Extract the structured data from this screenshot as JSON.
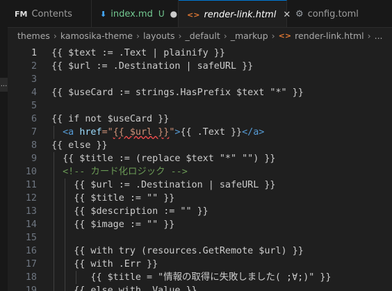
{
  "tabs": [
    {
      "icon": "FM",
      "label": "Contents"
    },
    {
      "icon": "⬇",
      "label": "index.md",
      "status": "U"
    },
    {
      "icon": "<>",
      "label": "render-link.html",
      "close": "✕"
    },
    {
      "icon": "⚙",
      "label": "config.toml"
    }
  ],
  "breadcrumb": [
    "themes",
    "kamosika-theme",
    "layouts",
    "_default",
    "_markup",
    "render-link.html",
    "..."
  ],
  "left_marker": "...",
  "lines": [
    {
      "n": "1",
      "parts": [
        {
          "t": "{{ $text := .Text | plainify }}"
        }
      ]
    },
    {
      "n": "2",
      "parts": [
        {
          "t": "{{ $url := .Destination | safeURL }}"
        }
      ]
    },
    {
      "n": "3",
      "parts": []
    },
    {
      "n": "4",
      "parts": [
        {
          "t": "{{ $useCard := strings.HasPrefix $text \"*\" }}"
        }
      ]
    },
    {
      "n": "5",
      "parts": []
    },
    {
      "n": "6",
      "parts": [
        {
          "t": "{{ if not $useCard }}"
        }
      ]
    },
    {
      "n": "7",
      "parts": [
        {
          "t": "  "
        },
        {
          "t": "<a",
          "c": "tag"
        },
        {
          "t": " "
        },
        {
          "t": "href",
          "c": "attr"
        },
        {
          "t": "=",
          "c": "str"
        },
        {
          "t": "\"",
          "c": "str"
        },
        {
          "t": "{{ $url }}",
          "c": "str err"
        },
        {
          "t": "\"",
          "c": "str"
        },
        {
          "t": ">",
          "c": "tag"
        },
        {
          "t": "{{ .Text }}"
        },
        {
          "t": "</a>",
          "c": "tag"
        }
      ]
    },
    {
      "n": "8",
      "parts": [
        {
          "t": "{{ else }}"
        }
      ]
    },
    {
      "n": "9",
      "parts": [
        {
          "t": "  {{ $title := (replace $text \"*\" \"\") }}"
        }
      ]
    },
    {
      "n": "10",
      "parts": [
        {
          "t": "  "
        },
        {
          "t": "<!-- カード化ロジック -->",
          "c": "cm"
        }
      ]
    },
    {
      "n": "11",
      "parts": [
        {
          "t": "    {{ $url := .Destination | safeURL }}"
        }
      ]
    },
    {
      "n": "12",
      "parts": [
        {
          "t": "    {{ $title := \"\" }}"
        }
      ]
    },
    {
      "n": "13",
      "parts": [
        {
          "t": "    {{ $description := \"\" }}"
        }
      ]
    },
    {
      "n": "14",
      "parts": [
        {
          "t": "    {{ $image := \"\" }}"
        }
      ]
    },
    {
      "n": "15",
      "parts": []
    },
    {
      "n": "16",
      "parts": [
        {
          "t": "    {{ with try (resources.GetRemote $url) }}"
        }
      ]
    },
    {
      "n": "17",
      "parts": [
        {
          "t": "    {{ with .Err }}"
        }
      ]
    },
    {
      "n": "18",
      "parts": [
        {
          "t": "       {{ $title = \"情報の取得に失敗しました( ;∀;)\" }}"
        }
      ]
    },
    {
      "n": "19",
      "parts": [
        {
          "t": "    {{ else with .Value }}"
        }
      ]
    }
  ]
}
